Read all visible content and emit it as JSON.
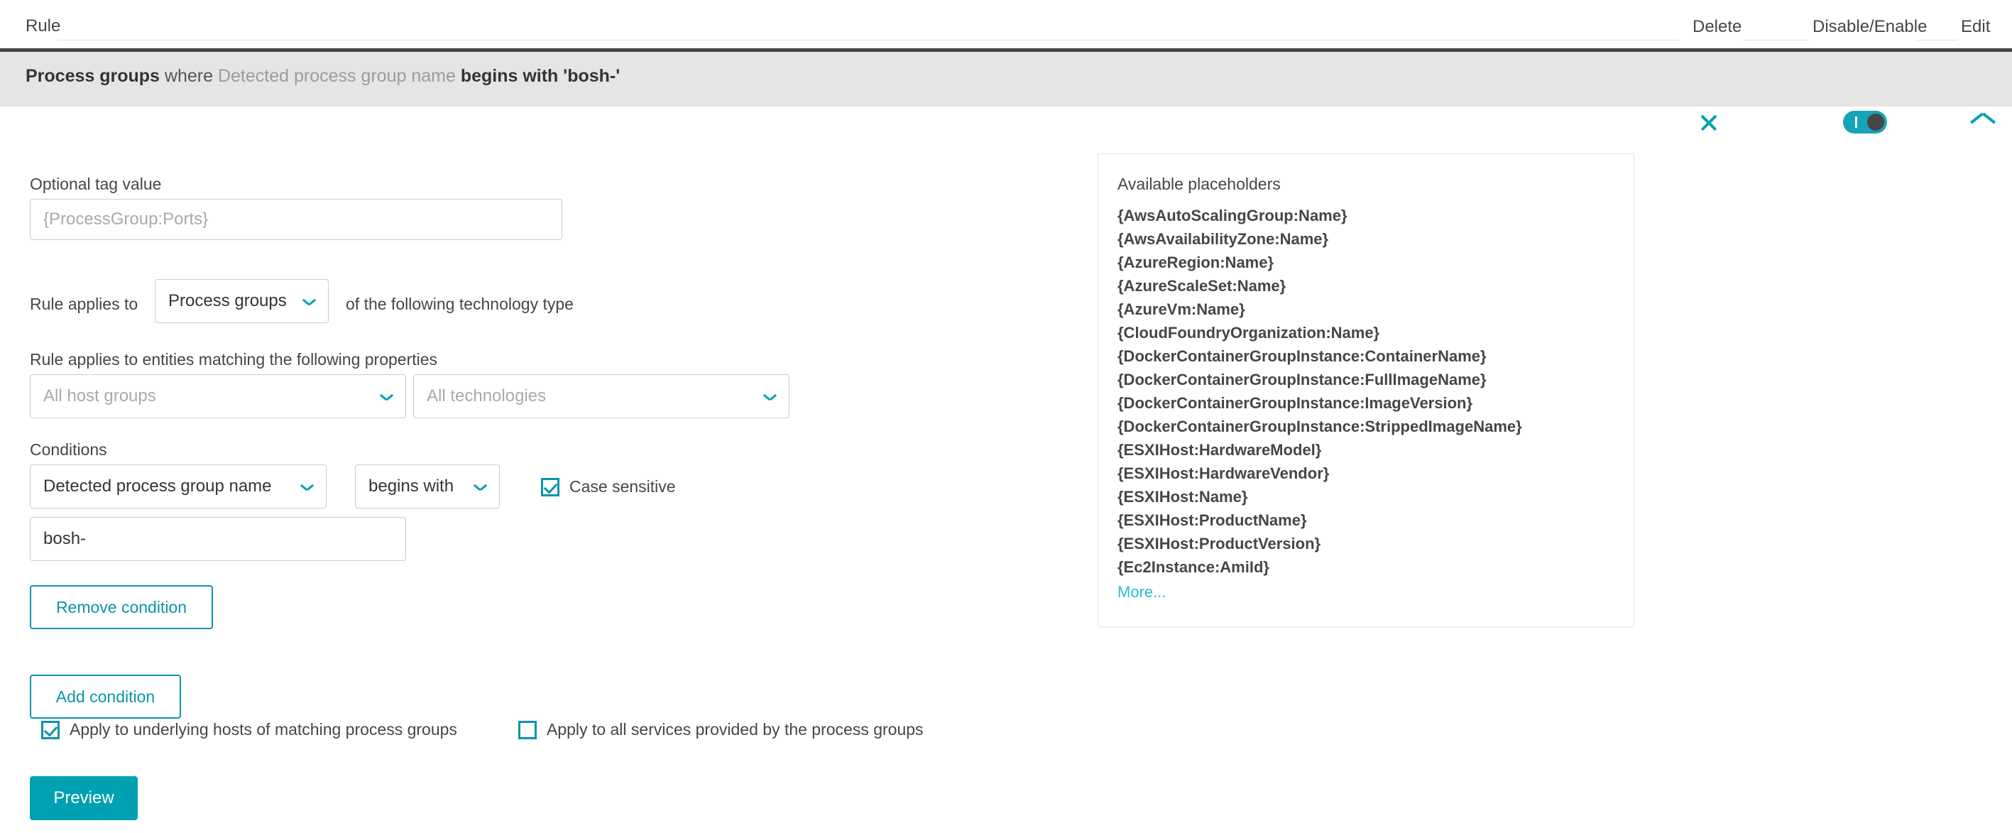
{
  "header": {
    "rule_label": "Rule",
    "delete_label": "Delete",
    "disable_enable_label": "Disable/Enable",
    "edit_label": "Edit"
  },
  "rule_banner": {
    "subject": "Process groups",
    "connector": "where",
    "attribute": "Detected process group name",
    "predicate": "begins with 'bosh-'",
    "close_icon": "close-icon",
    "toggle_state": "on",
    "collapse_icon": "chevron-up-icon"
  },
  "form": {
    "tag_value_label": "Optional tag value",
    "tag_value": "",
    "tag_value_placeholder": "{ProcessGroup:Ports}",
    "rule_applies_to_label": "Rule applies to",
    "rule_applies_to_value": "Process groups",
    "technology_type_suffix": "of the following technology type",
    "entities_matching_label": "Rule applies to entities matching the following properties",
    "host_groups_value": "All host groups",
    "technologies_value": "All technologies",
    "conditions_label": "Conditions",
    "condition_attribute": "Detected process group name",
    "condition_operator": "begins with",
    "case_sensitive_label": "Case sensitive",
    "case_sensitive_checked": true,
    "condition_value": "bosh-",
    "remove_condition_label": "Remove condition",
    "add_condition_label": "Add condition",
    "apply_hosts_label": "Apply to underlying hosts of matching process groups",
    "apply_hosts_checked": true,
    "apply_services_label": "Apply to all services provided by the process groups",
    "apply_services_checked": false,
    "preview_label": "Preview"
  },
  "placeholders_panel": {
    "title": "Available placeholders",
    "items": [
      "{AwsAutoScalingGroup:Name}",
      "{AwsAvailabilityZone:Name}",
      "{AzureRegion:Name}",
      "{AzureScaleSet:Name}",
      "{AzureVm:Name}",
      "{CloudFoundryOrganization:Name}",
      "{DockerContainerGroupInstance:ContainerName}",
      "{DockerContainerGroupInstance:FullImageName}",
      "{DockerContainerGroupInstance:ImageVersion}",
      "{DockerContainerGroupInstance:StrippedImageName}",
      "{ESXIHost:HardwareModel}",
      "{ESXIHost:HardwareVendor}",
      "{ESXIHost:Name}",
      "{ESXIHost:ProductName}",
      "{ESXIHost:ProductVersion}",
      "{Ec2Instance:AmiId}"
    ],
    "more_label": "More..."
  },
  "colors": {
    "accent": "#00a1b2",
    "accent_dark": "#0c94ab",
    "banner_bg": "#e5e5e5",
    "banner_border": "#454545",
    "link": "#2bbbd8"
  }
}
